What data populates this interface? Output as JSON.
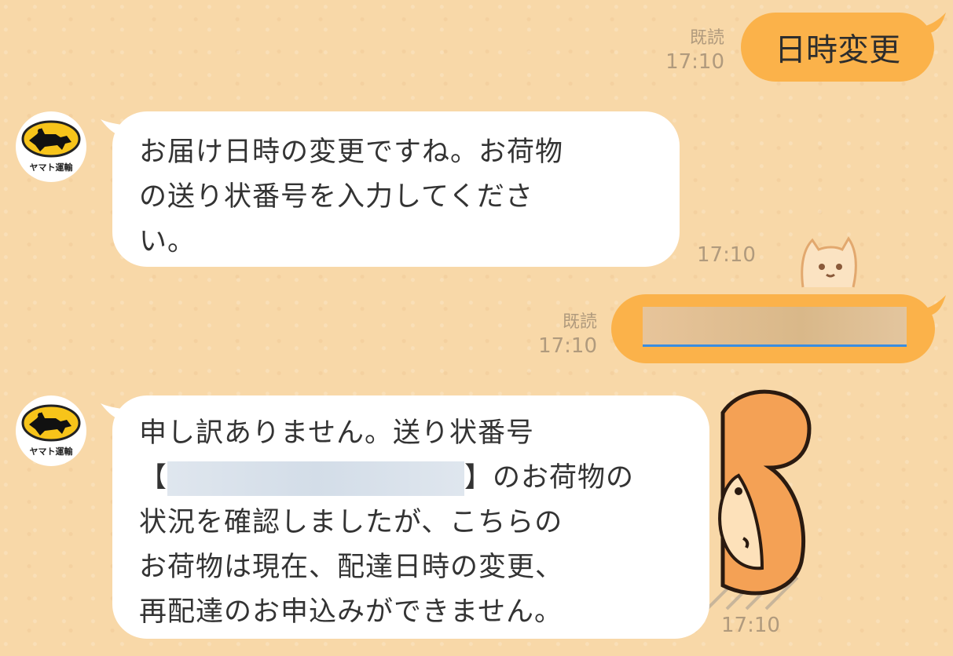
{
  "messages": [
    {
      "id": "m1",
      "direction": "sent",
      "text": "日時変更",
      "read_label": "既読",
      "time": "17:10"
    },
    {
      "id": "m2",
      "direction": "received",
      "sender_label": "ヤマト運輸",
      "lines": [
        "お届け日時の変更ですね。お荷物",
        "の送り状番号を入力してくださ",
        "い。"
      ],
      "time": "17:10"
    },
    {
      "id": "m3",
      "direction": "sent",
      "read_label": "既読",
      "time": "17:10",
      "redacted": true
    },
    {
      "id": "m4",
      "direction": "received",
      "sender_label": "ヤマト運輸",
      "line1": "申し訳ありません。送り状番号",
      "bracket_open": "【",
      "bracket_close": "】",
      "line2_tail": "のお荷物の",
      "line3": "状況を確認しましたが、こちらの",
      "line4": "お荷物は現在、配達日時の変更、",
      "line5": "再配達のお申込みができません。",
      "time": "17:10"
    }
  ],
  "colors": {
    "sent_bubble": "#fbb24a",
    "received_bubble": "#ffffff",
    "background": "#f8d8a8",
    "link": "#3a8de0"
  },
  "icons": {
    "avatar": "black-cat-logo",
    "sticker_peek": "cat-peek-sticker",
    "sticker_squirrel": "squirrel-sticker"
  }
}
